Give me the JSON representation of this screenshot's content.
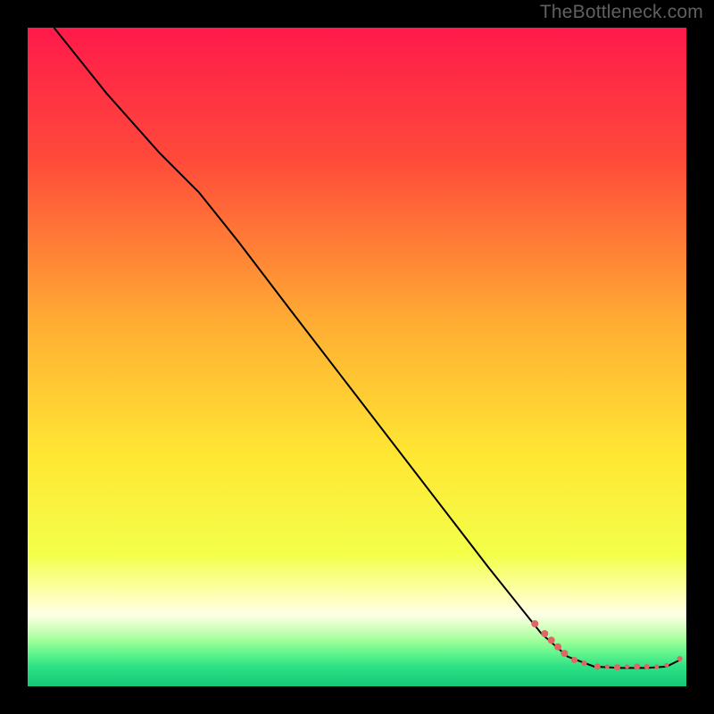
{
  "watermark": "TheBottleneck.com",
  "chart_data": {
    "type": "line",
    "title": "",
    "xlabel": "",
    "ylabel": "",
    "xlim": [
      0,
      100
    ],
    "ylim": [
      0,
      100
    ],
    "gradient_stops": [
      {
        "offset": 0,
        "color": "#ff1a4b"
      },
      {
        "offset": 20,
        "color": "#ff4a3a"
      },
      {
        "offset": 45,
        "color": "#ffae33"
      },
      {
        "offset": 65,
        "color": "#ffe733"
      },
      {
        "offset": 80,
        "color": "#f3ff4a"
      },
      {
        "offset": 86,
        "color": "#fdffb0"
      },
      {
        "offset": 89,
        "color": "#ffffe6"
      },
      {
        "offset": 91,
        "color": "#d7ffc1"
      },
      {
        "offset": 93,
        "color": "#a1ff9a"
      },
      {
        "offset": 95,
        "color": "#62f58d"
      },
      {
        "offset": 97,
        "color": "#2de184"
      },
      {
        "offset": 100,
        "color": "#14c878"
      }
    ],
    "series": [
      {
        "name": "bottleneck-curve",
        "stroke": "#000000",
        "points": [
          {
            "x": 4.0,
            "y": 100.0
          },
          {
            "x": 12.0,
            "y": 90.0
          },
          {
            "x": 20.0,
            "y": 81.0
          },
          {
            "x": 26.0,
            "y": 75.0
          },
          {
            "x": 32.0,
            "y": 67.5
          },
          {
            "x": 40.0,
            "y": 57.0
          },
          {
            "x": 50.0,
            "y": 44.0
          },
          {
            "x": 60.0,
            "y": 31.0
          },
          {
            "x": 70.0,
            "y": 18.0
          },
          {
            "x": 78.0,
            "y": 8.0
          },
          {
            "x": 82.0,
            "y": 4.5
          },
          {
            "x": 86.0,
            "y": 3.0
          },
          {
            "x": 90.0,
            "y": 2.8
          },
          {
            "x": 94.0,
            "y": 2.8
          },
          {
            "x": 97.0,
            "y": 3.0
          },
          {
            "x": 99.0,
            "y": 4.0
          }
        ]
      }
    ],
    "scatter": {
      "name": "highlight-points",
      "color": "#e06666",
      "points": [
        {
          "x": 77.0,
          "y": 9.5,
          "r": 4.0
        },
        {
          "x": 78.5,
          "y": 8.0,
          "r": 4.0
        },
        {
          "x": 79.5,
          "y": 7.0,
          "r": 4.0
        },
        {
          "x": 80.5,
          "y": 6.0,
          "r": 4.0
        },
        {
          "x": 81.5,
          "y": 5.0,
          "r": 4.0
        },
        {
          "x": 83.0,
          "y": 4.0,
          "r": 3.5
        },
        {
          "x": 84.5,
          "y": 3.5,
          "r": 3.0
        },
        {
          "x": 86.5,
          "y": 3.0,
          "r": 3.5
        },
        {
          "x": 88.0,
          "y": 3.0,
          "r": 2.5
        },
        {
          "x": 89.5,
          "y": 2.9,
          "r": 3.5
        },
        {
          "x": 91.0,
          "y": 3.0,
          "r": 2.5
        },
        {
          "x": 92.5,
          "y": 3.0,
          "r": 3.5
        },
        {
          "x": 94.0,
          "y": 3.0,
          "r": 3.0
        },
        {
          "x": 95.5,
          "y": 3.0,
          "r": 2.5
        },
        {
          "x": 97.0,
          "y": 3.2,
          "r": 2.5
        },
        {
          "x": 99.0,
          "y": 4.2,
          "r": 3.0
        }
      ]
    }
  }
}
